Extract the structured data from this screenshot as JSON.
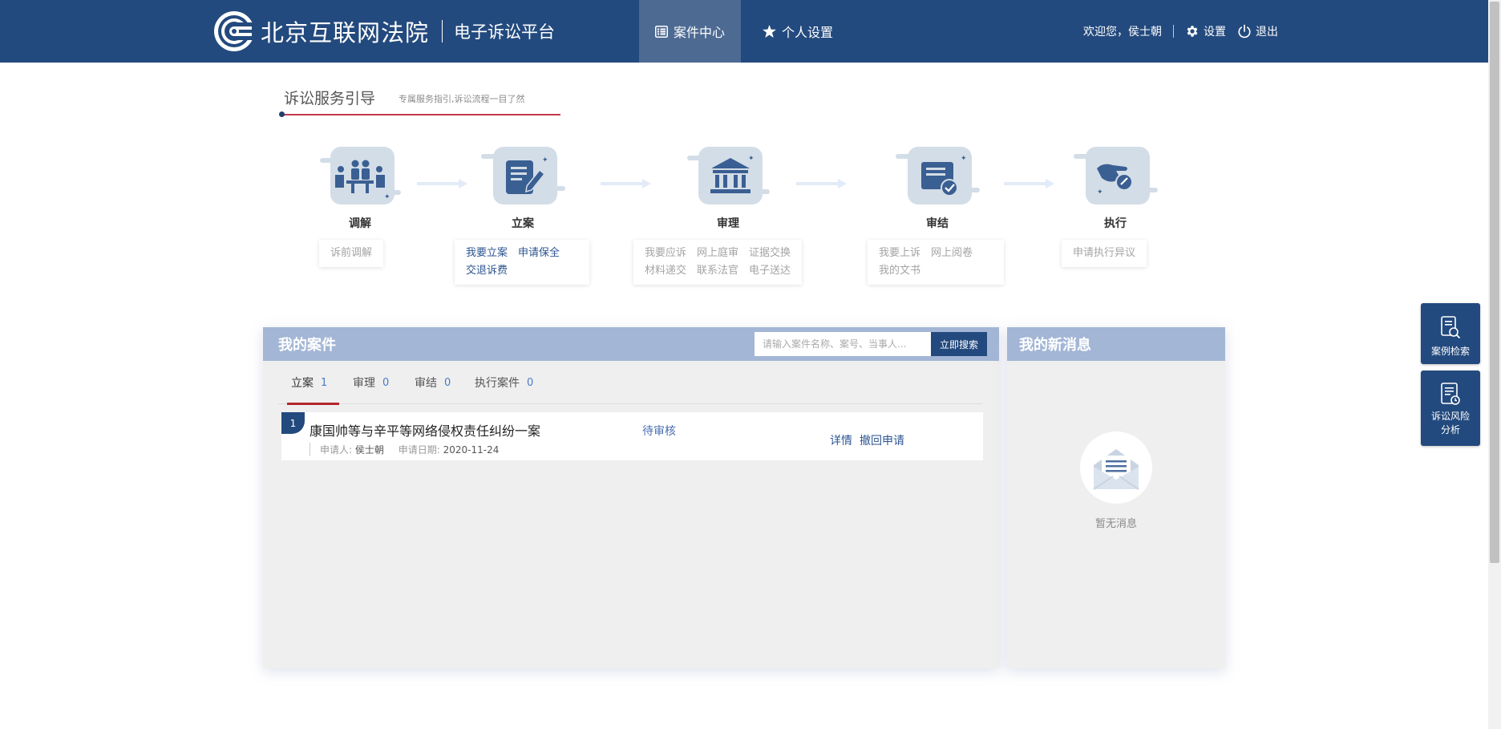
{
  "header": {
    "court_name": "北京互联网法院",
    "platform_name": "电子诉讼平台",
    "nav": [
      {
        "label": "案件中心",
        "icon": "list-icon",
        "active": true
      },
      {
        "label": "个人设置",
        "icon": "star-icon",
        "active": false
      }
    ],
    "welcome": "欢迎您，侯士朝",
    "settings_label": "设置",
    "logout_label": "退出"
  },
  "guide": {
    "title": "诉讼服务引导",
    "subtitle": "专属服务指引,诉讼流程一目了然",
    "steps": [
      {
        "label": "调解",
        "icon": "mediation-icon",
        "links": [
          [
            "诉前调解"
          ]
        ],
        "enabled": false
      },
      {
        "label": "立案",
        "icon": "filing-icon",
        "links": [
          [
            "我要立案",
            "申请保全"
          ],
          [
            "交退诉费"
          ]
        ],
        "enabled": true
      },
      {
        "label": "审理",
        "icon": "court-icon",
        "links": [
          [
            "我要应诉",
            "网上庭审",
            "证据交换"
          ],
          [
            "材料递交",
            "联系法官",
            "电子送达"
          ]
        ],
        "enabled": false
      },
      {
        "label": "审结",
        "icon": "closing-icon",
        "links": [
          [
            "我要上诉",
            "网上阅卷"
          ],
          [
            "我的文书"
          ]
        ],
        "enabled": false
      },
      {
        "label": "执行",
        "icon": "execution-icon",
        "links": [
          [
            "申请执行异议"
          ]
        ],
        "enabled": false
      }
    ]
  },
  "cases": {
    "title": "我的案件",
    "search_placeholder": "请输入案件名称、案号、当事人...",
    "search_button": "立即搜索",
    "tabs": [
      {
        "label": "立案",
        "count": "1",
        "active": true
      },
      {
        "label": "审理",
        "count": "0",
        "active": false
      },
      {
        "label": "审结",
        "count": "0",
        "active": false
      },
      {
        "label": "执行案件",
        "count": "0",
        "active": false
      }
    ],
    "rows": [
      {
        "index": "1",
        "name": "康国帅等与辛平等网络侵权责任纠纷一案",
        "applicant_label": "申请人:",
        "applicant": "侯士朝",
        "date_label": "申请日期:",
        "date": "2020-11-24",
        "status": "待审核",
        "actions": [
          "详情",
          "撤回申请"
        ]
      }
    ]
  },
  "messages": {
    "title": "我的新消息",
    "empty_text": "暂无消息"
  },
  "float_buttons": [
    {
      "label": "案例检索",
      "icon": "case-search-icon"
    },
    {
      "label": "诉讼风险分析",
      "icon": "risk-analysis-icon"
    }
  ],
  "colors": {
    "brand": "#234a7e",
    "nav_active": "#4d6a93",
    "panel_header": "#a3b6d6",
    "tab_underline": "#b3262e",
    "link": "#2d5591"
  }
}
